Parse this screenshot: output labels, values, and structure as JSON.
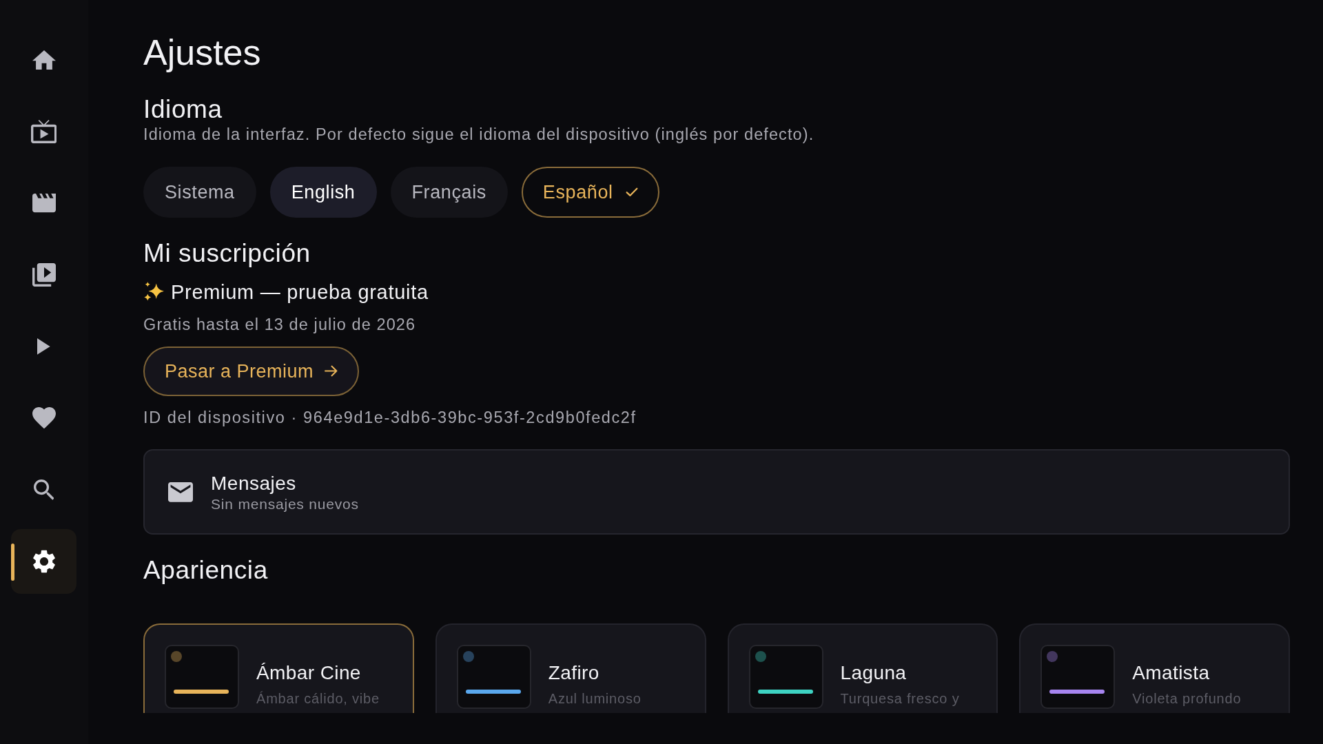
{
  "sidebar": {
    "items": [
      {
        "selected": false
      },
      {
        "selected": false
      },
      {
        "selected": false
      },
      {
        "selected": false
      },
      {
        "selected": false
      },
      {
        "selected": false
      },
      {
        "selected": false
      },
      {
        "selected": true
      }
    ]
  },
  "page_title": "Ajustes",
  "language": {
    "title": "Idioma",
    "description": "Idioma de la interfaz. Por defecto sigue el idioma del dispositivo (inglés por defecto).",
    "options": [
      {
        "label": "Sistema",
        "selected": false,
        "focused": false
      },
      {
        "label": "English",
        "selected": false,
        "focused": true
      },
      {
        "label": "Français",
        "selected": false,
        "focused": false
      },
      {
        "label": "Español",
        "selected": true,
        "focused": false
      }
    ]
  },
  "subscription": {
    "title": "Mi suscripción",
    "plan": "Premium — prueba gratuita",
    "status": "Gratis hasta el 13 de julio de 2026",
    "upgrade_button": "Pasar a Premium",
    "device_id": "ID del dispositivo · 964e9d1e-3db6-39bc-953f-2cd9b0fedc2f"
  },
  "messages": {
    "title": "Mensajes",
    "subtitle": "Sin mensajes nuevos"
  },
  "appearance": {
    "title": "Apariencia",
    "themes": [
      {
        "name": "Ámbar Cine",
        "description": "Ámbar cálido, vibe",
        "color": "#e8b45a",
        "selected": true
      },
      {
        "name": "Zafiro",
        "description": "Azul luminoso",
        "color": "#5aa8ee",
        "selected": false
      },
      {
        "name": "Laguna",
        "description": "Turquesa fresco y",
        "color": "#3ed3c3",
        "selected": false
      },
      {
        "name": "Amatista",
        "description": "Violeta profundo",
        "color": "#a785f0",
        "selected": false
      }
    ]
  }
}
